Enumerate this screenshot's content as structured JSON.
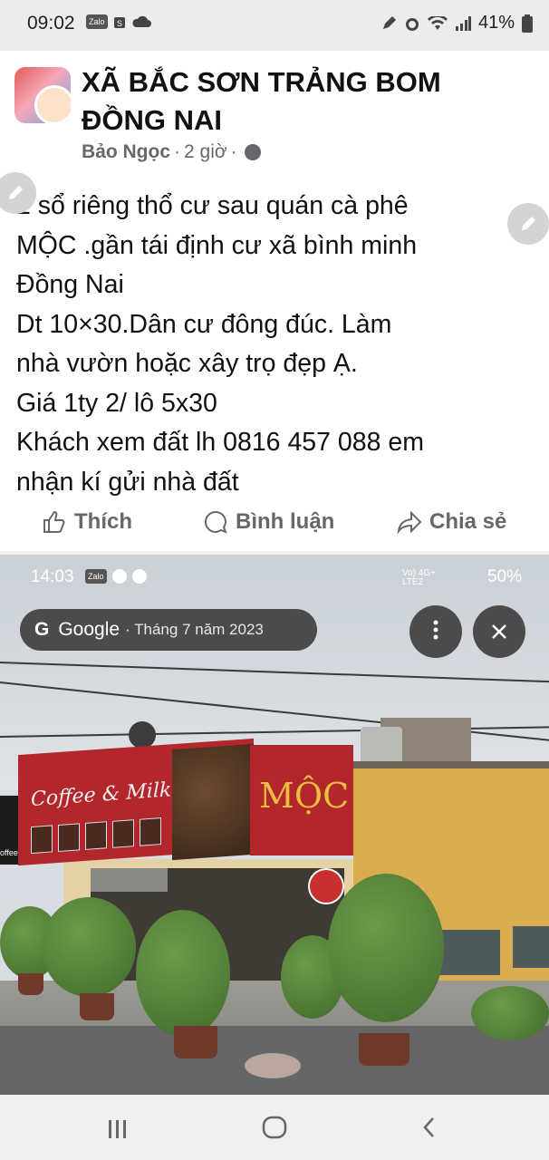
{
  "status_bar": {
    "time": "09:02",
    "left_icons": [
      "zalo-icon",
      "sendo-icon",
      "cloud-icon"
    ],
    "zalo_label": "Zalo",
    "battery": "41%",
    "right_icons": [
      "edit-icon",
      "alarm-icon",
      "wifi-icon",
      "signal-icon",
      "battery-icon"
    ]
  },
  "post": {
    "group_name": "XÃ BẮC SƠN TRẢNG BOM ĐỒNG NAI",
    "author": "Bảo Ngọc",
    "separator": "·",
    "time_ago": "2 giờ",
    "privacy_icon": "globe-icon",
    "text_lines": [
      "2 sổ riêng thổ cư sau quán cà phê",
      "MỘC .gần tái định cư xã bình minh",
      "Đồng Nai",
      "Dt 10×30.Dân cư đông đúc. Làm",
      "nhà vườn hoặc xây trọ đẹp Ạ.",
      "Giá 1ty 2/ lô 5x30",
      "Khách xem đất lh 0816 457 088 em",
      "nhận kí gửi nhà đất"
    ],
    "actions": {
      "like": "Thích",
      "comment": "Bình luận",
      "share": "Chia sẻ"
    }
  },
  "photo": {
    "inner_status_time": "14:03",
    "inner_status_battery": "50%",
    "inner_network": "Vo) 4G+ LTE2",
    "google_label": "Google",
    "date_text": "· Tháng 7 năm 2023",
    "sign_coffee": "Coffee & Milk Tea",
    "sign_brand": "MỘC",
    "sign_left_bottom": "offee & Milk Tea"
  },
  "colors": {
    "accent_text": "#65676b",
    "sign_red": "#b3262b",
    "sign_gold": "#e8c040"
  }
}
